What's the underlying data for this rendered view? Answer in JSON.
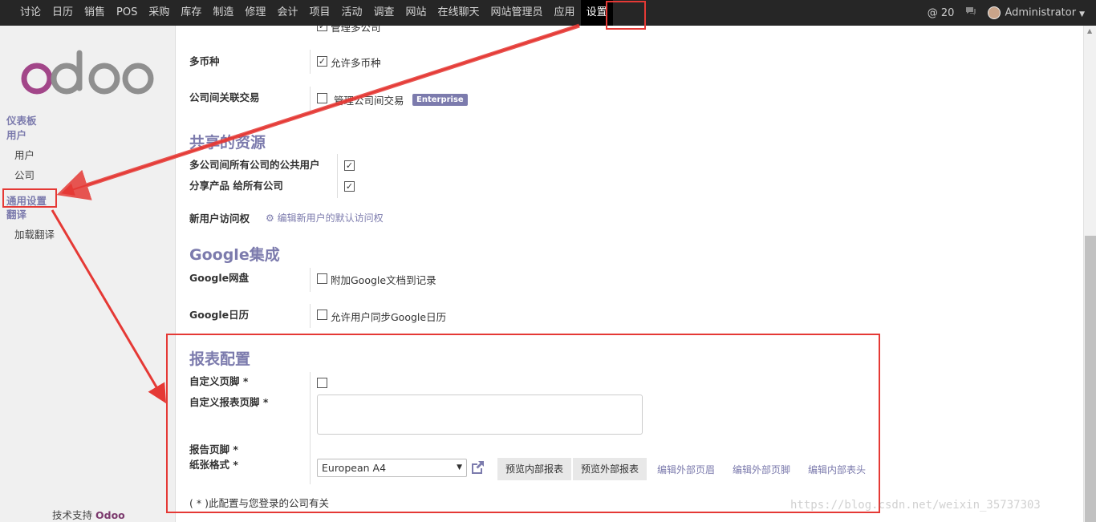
{
  "topbar": {
    "menu": [
      "讨论",
      "日历",
      "销售",
      "POS",
      "采购",
      "库存",
      "制造",
      "修理",
      "会计",
      "项目",
      "活动",
      "调查",
      "网站",
      "在线聊天",
      "网站管理员",
      "应用",
      "设置"
    ],
    "active_menu": "设置",
    "notifications": "@ 20",
    "user": "Administrator"
  },
  "sidebar": {
    "dashboard": "仪表板",
    "users_group": "用户",
    "users": "用户",
    "companies": "公司",
    "general_settings": "通用设置",
    "translations_group": "翻译",
    "load_translation": "加载翻译",
    "footer_prefix": "技术支持",
    "footer_brand": "Odoo"
  },
  "main": {
    "clipped_option": "管理多公司",
    "multi_currency": {
      "label": "多币种",
      "option": "允许多币种",
      "checked": true
    },
    "inter_company": {
      "label": "公司间关联交易",
      "option": "管理公司间交易",
      "badge": "Enterprise",
      "checked": false
    },
    "shared_resources": {
      "title": "共享的资源",
      "public_users": {
        "label": "多公司间所有公司的公共用户",
        "checked": true
      },
      "share_products": {
        "label": "分享产品 给所有公司",
        "checked": true
      }
    },
    "new_user_access": {
      "label": "新用户访问权",
      "link": "编辑新用户的默认访问权"
    },
    "google": {
      "title": "Google集成",
      "drive": {
        "label": "Google网盘",
        "option": "附加Google文档到记录",
        "checked": false
      },
      "calendar": {
        "label": "Google日历",
        "option": "允许用户同步Google日历",
        "checked": false
      }
    },
    "report": {
      "title": "报表配置",
      "custom_footer": {
        "label": "自定义页脚 *",
        "checked": false
      },
      "custom_report_footer": {
        "label": "自定义报表页脚 *",
        "value": ""
      },
      "report_footer": {
        "label": "报告页脚 *"
      },
      "paper_format": {
        "label": "纸张格式 *",
        "value": "European A4"
      },
      "buttons": [
        "预览内部报表",
        "预览外部报表"
      ],
      "links": [
        "编辑外部页眉",
        "编辑外部页脚",
        "编辑内部表头"
      ],
      "note": "( * )此配置与您登录的公司有关"
    }
  },
  "watermark": "https://blog.csdn.net/weixin_35737303",
  "colors": {
    "accent": "#7c7bad",
    "annotation": "#e53935",
    "topbar": "#262626"
  }
}
